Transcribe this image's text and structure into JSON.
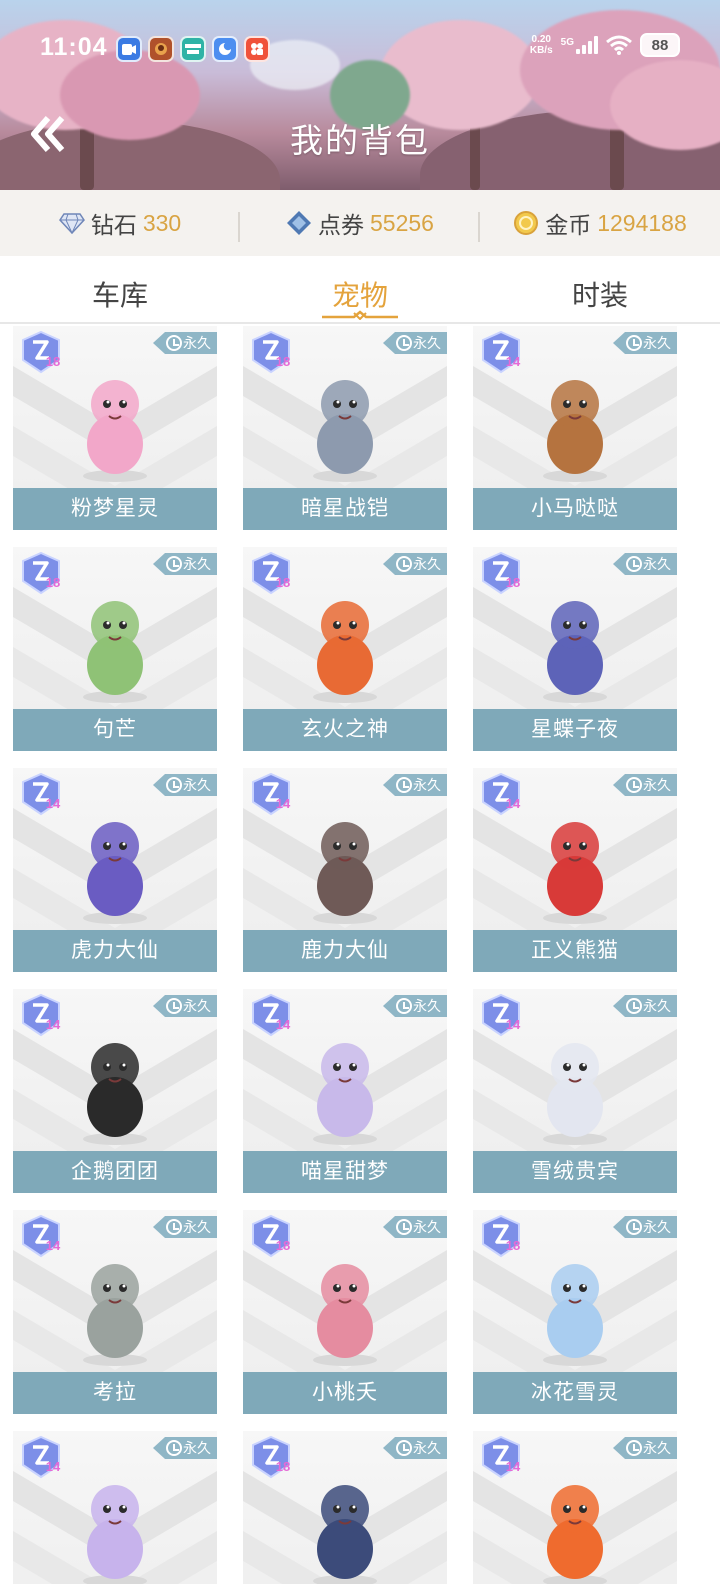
{
  "status_bar": {
    "time": "11:04",
    "net_speed_value": "0.20",
    "net_speed_unit": "KB/s",
    "signal": "5G",
    "battery": "88",
    "app_icons": [
      "video-app-icon",
      "game-hero-icon",
      "boss-app-icon",
      "browser-app-icon",
      "gallery-app-icon"
    ]
  },
  "header": {
    "title": "我的背包"
  },
  "currency": {
    "diamond": {
      "label": "钻石",
      "value": "330"
    },
    "coupon": {
      "label": "点券",
      "value": "55256"
    },
    "gold": {
      "label": "金币",
      "value": "1294188"
    }
  },
  "tabs": [
    {
      "label": "车库",
      "active": false
    },
    {
      "label": "宠物",
      "active": true
    },
    {
      "label": "时装",
      "active": false
    }
  ],
  "pets": [
    {
      "name": "粉梦星灵",
      "level": "18",
      "duration": "永久",
      "color": "#f2a7c9"
    },
    {
      "name": "暗星战铠",
      "level": "18",
      "duration": "永久",
      "color": "#8d9aae"
    },
    {
      "name": "小马哒哒",
      "level": "14",
      "duration": "永久",
      "color": "#b5733f"
    },
    {
      "name": "句芒",
      "level": "18",
      "duration": "永久",
      "color": "#8fc276"
    },
    {
      "name": "玄火之神",
      "level": "18",
      "duration": "永久",
      "color": "#e86a34"
    },
    {
      "name": "星蝶子夜",
      "level": "18",
      "duration": "永久",
      "color": "#5d63b8"
    },
    {
      "name": "虎力大仙",
      "level": "14",
      "duration": "永久",
      "color": "#6a5cc2"
    },
    {
      "name": "鹿力大仙",
      "level": "14",
      "duration": "永久",
      "color": "#6f5a57"
    },
    {
      "name": "正义熊猫",
      "level": "14",
      "duration": "永久",
      "color": "#d83a38"
    },
    {
      "name": "企鹅团团",
      "level": "14",
      "duration": "永久",
      "color": "#2a2a2a"
    },
    {
      "name": "喵星甜梦",
      "level": "14",
      "duration": "永久",
      "color": "#c8b9ea"
    },
    {
      "name": "雪绒贵宾",
      "level": "14",
      "duration": "永久",
      "color": "#e3e6f0"
    },
    {
      "name": "考拉",
      "level": "14",
      "duration": "永久",
      "color": "#9aa29e"
    },
    {
      "name": "小桃夭",
      "level": "18",
      "duration": "永久",
      "color": "#e58ca0"
    },
    {
      "name": "冰花雪灵",
      "level": "18",
      "duration": "永久",
      "color": "#a9cdf0"
    },
    {
      "name": "",
      "level": "14",
      "duration": "永久",
      "color": "#c7b3ec"
    },
    {
      "name": "",
      "level": "18",
      "duration": "永久",
      "color": "#3c4b7a"
    },
    {
      "name": "",
      "level": "14",
      "duration": "永久",
      "color": "#ef6b2e"
    }
  ]
}
